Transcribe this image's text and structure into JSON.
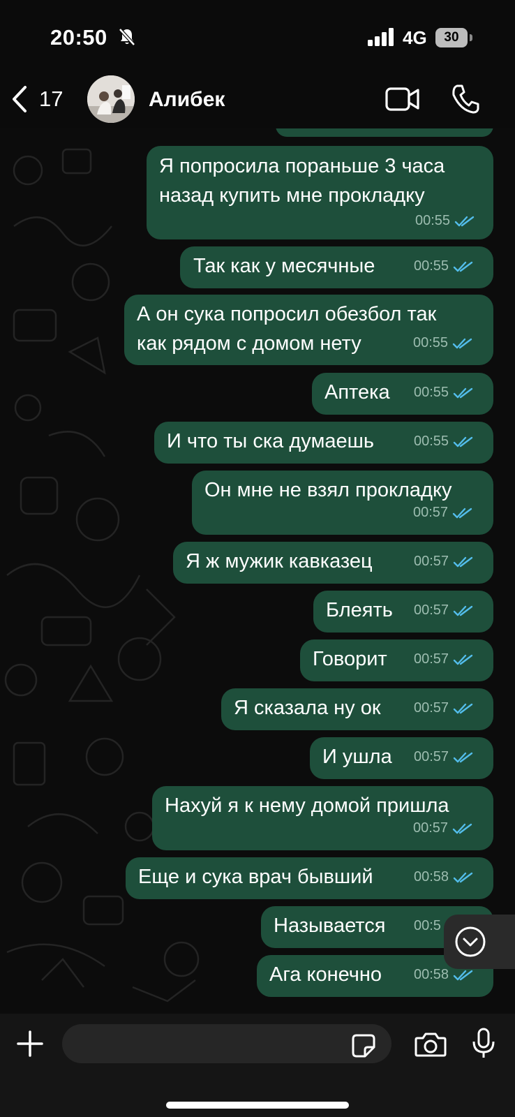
{
  "status_bar": {
    "time": "20:50",
    "network": "4G",
    "battery": "30"
  },
  "header": {
    "back_count": "17",
    "contact_name": "Алибек"
  },
  "messages": [
    {
      "text_lines": [
        "Я попросила пораньше 3 часа",
        "назад купить мне прокладку"
      ],
      "time": "00:55"
    },
    {
      "text_lines": [
        "Так как у месячные"
      ],
      "time": "00:55"
    },
    {
      "text_lines": [
        "А он сука попросил обезбол так",
        "как рядом с домом нету"
      ],
      "time": "00:55"
    },
    {
      "text_lines": [
        "Аптека"
      ],
      "time": "00:55"
    },
    {
      "text_lines": [
        "И что ты ска думаешь"
      ],
      "time": "00:55"
    },
    {
      "text_lines": [
        "Он мне не взял прокладку"
      ],
      "time": "00:57"
    },
    {
      "text_lines": [
        "Я ж мужик кавказец"
      ],
      "time": "00:57"
    },
    {
      "text_lines": [
        "Блеять"
      ],
      "time": "00:57"
    },
    {
      "text_lines": [
        "Говорит"
      ],
      "time": "00:57"
    },
    {
      "text_lines": [
        "Я сказала ну ок"
      ],
      "time": "00:57"
    },
    {
      "text_lines": [
        "И ушла"
      ],
      "time": "00:57"
    },
    {
      "text_lines": [
        "Нахуй я к нему домой пришла"
      ],
      "time": "00:57"
    },
    {
      "text_lines": [
        "Еще и сука врач бывший"
      ],
      "time": "00:58"
    },
    {
      "text_lines": [
        "Называется"
      ],
      "time": "00:5"
    },
    {
      "text_lines": [
        "Ага конечно"
      ],
      "time": "00:58"
    }
  ],
  "input": {
    "placeholder": ""
  },
  "colors": {
    "outgoing_bubble": "#1e4f3b",
    "read_ticks": "#53bdeb",
    "background": "#0b0b0b"
  },
  "icons": [
    "back-chevron-icon",
    "video-call-icon",
    "phone-icon",
    "scroll-down-icon",
    "plus-icon",
    "sticker-icon",
    "camera-icon",
    "mic-icon",
    "silent-bell-icon",
    "signal-icon"
  ]
}
